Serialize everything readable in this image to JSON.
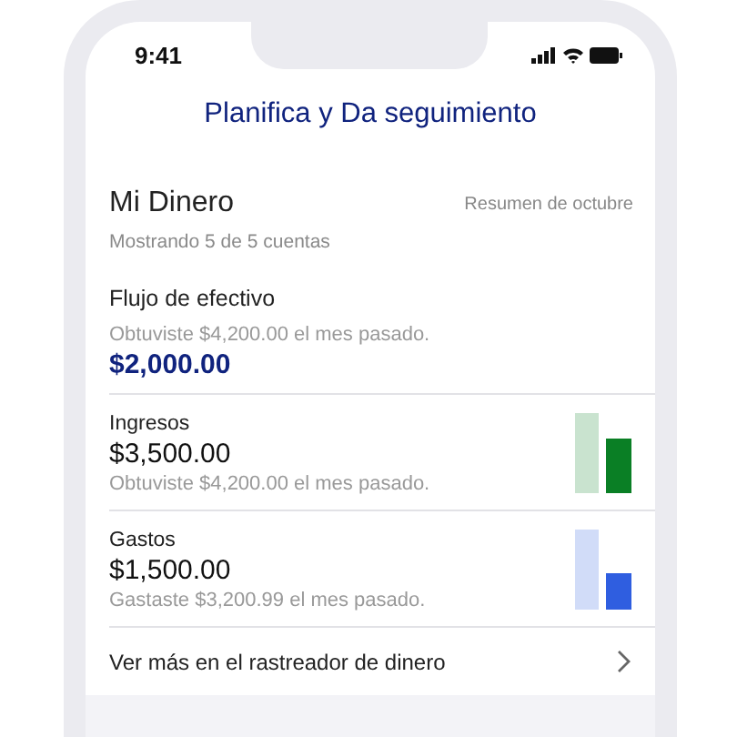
{
  "status_bar": {
    "time": "9:41"
  },
  "header": {
    "title": "Planifica y Da seguimiento"
  },
  "card": {
    "title": "Mi Dinero",
    "summary_link": "Resumen de octubre",
    "subtitle": "Mostrando 5 de 5 cuentas",
    "cash_flow": {
      "label": "Flujo de efectivo",
      "note": "Obtuviste $4,200.00 el mes pasado.",
      "amount": "$2,000.00"
    },
    "rows": [
      {
        "label": "Ingresos",
        "amount": "$3,500.00",
        "note": "Obtuviste $4,200.00 el mes pasado.",
        "color": "#0a7f25"
      },
      {
        "label": "Gastos",
        "amount": "$1,500.00",
        "note": "Gastaste $3,200.99 el mes pasado.",
        "color": "#2f5ee0"
      }
    ],
    "more_link": "Ver más en el rastreador de dinero"
  }
}
